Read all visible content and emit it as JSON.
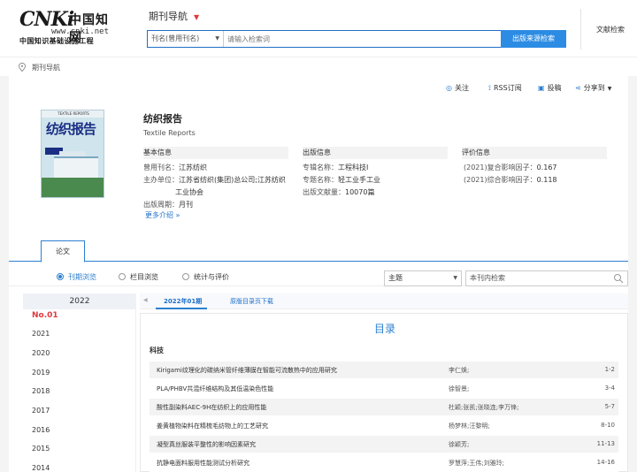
{
  "header": {
    "logo_brand": "CNKi",
    "logo_brand_cn": "中国知网",
    "logo_www": "www.cnki.net",
    "logo_subtitle": "中国知识基础设施工程",
    "nav_label": "期刊导航",
    "search_field": "刊名(曾用刊名)",
    "search_placeholder": "请输入检索词",
    "search_button": "出版来源检索",
    "user_link": "文献检索"
  },
  "breadcrumb": {
    "label": "期刊导航"
  },
  "actions": {
    "follow": "关注",
    "rss": "RSS订阅",
    "submit": "投稿",
    "share": "分享到"
  },
  "journal": {
    "cover_title": "纺织报告",
    "cover_top": "TEXTILE REPORTS",
    "title": "纺织报告",
    "title_en": "Textile Reports",
    "basic_head": "基本信息",
    "former_name_label": "曾用刊名：",
    "former_name": "江苏纺织",
    "sponsor_label": "主办单位：",
    "sponsor_line1": "江苏省纺织(集团)总公司;江苏纺织",
    "sponsor_line2": "工业协会",
    "period_label": "出版周期：",
    "period": "月刊",
    "more": "更多介绍",
    "pub_head": "出版信息",
    "special_name_label": "专辑名称：",
    "special_name": "工程科技I",
    "topic_name_label": "专题名称：",
    "topic_name": "轻工业手工业",
    "doc_count_label": "出版文献量：",
    "doc_count": "10070篇",
    "eval_head": "评价信息",
    "impact1_label": "(2021)复合影响因子：",
    "impact1": "0.167",
    "impact2_label": "(2021)综合影响因子：",
    "impact2": "0.118"
  },
  "tabs": {
    "papers": "论文"
  },
  "browse": {
    "by_issue": "刊期浏览",
    "by_column": "栏目浏览",
    "stats": "统计与评价",
    "topic_select": "主题",
    "search_placeholder": "本刊内检索"
  },
  "years": {
    "current_year": "2022",
    "current_issue": "No.01",
    "list": [
      "2021",
      "2020",
      "2019",
      "2018",
      "2017",
      "2016",
      "2015",
      "2014"
    ]
  },
  "issue": {
    "current": "2022年01期",
    "download": "原版目录页下载",
    "toc_title": "目录",
    "category": "科技",
    "articles": [
      {
        "title": "Kirigami纹理化的碳纳米管纤维薄膜在智能可流散热中的应用研究",
        "authors": "李仁焕;",
        "pages": "1-2"
      },
      {
        "title": "PLA/PHBV共混纤维结构及其低温染色性能",
        "authors": "徐智景;",
        "pages": "3-4"
      },
      {
        "title": "酸性副染料AEC-9H在纺织上的应用性能",
        "authors": "杜颖;张凯;张晓连;李万锋;",
        "pages": "5-7"
      },
      {
        "title": "姜黄植物染料在精梳毛纺物上的工艺研究",
        "authors": "杨梦林;汪黎明;",
        "pages": "8-10"
      },
      {
        "title": "凝型真丝服装平整性的影响因素研究",
        "authors": "徐颖芳;",
        "pages": "11-13"
      },
      {
        "title": "抗静电面料服用性能测试分析研究",
        "authors": "罗慧萍;王伟;刘雅玲;",
        "pages": "14-16"
      }
    ]
  }
}
